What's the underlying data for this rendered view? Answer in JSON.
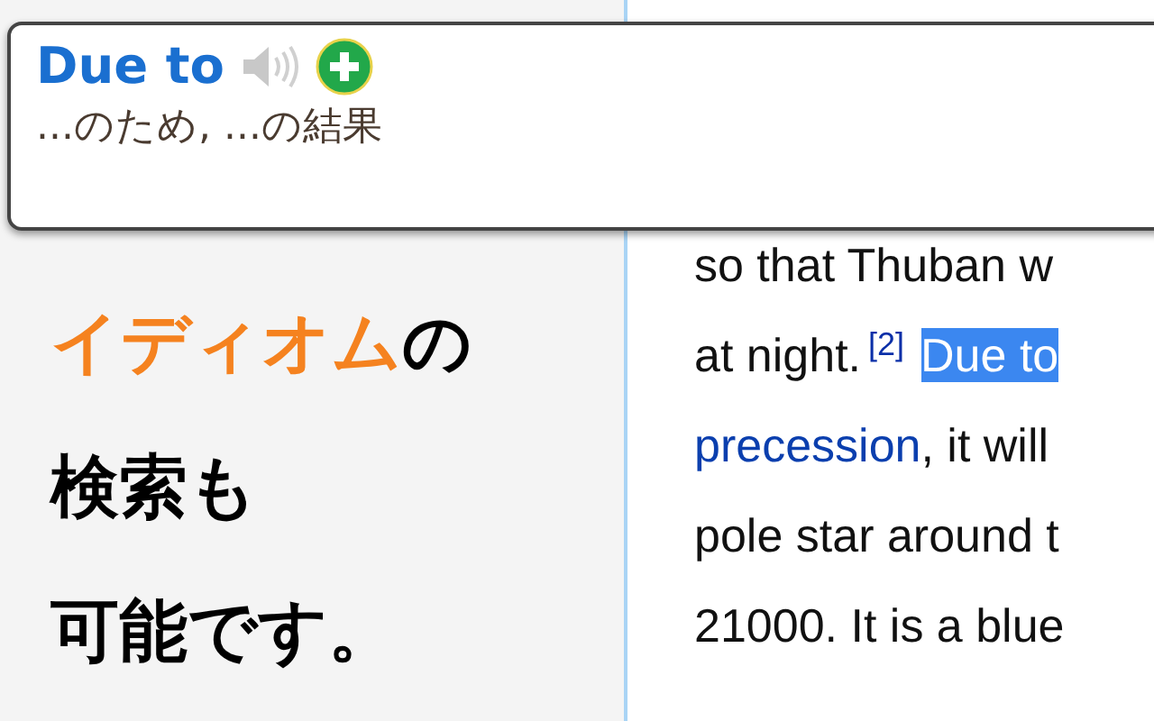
{
  "popup": {
    "term": "Due to",
    "meaning": "...のため, ...の結果",
    "audio_disabled": true
  },
  "tagline": [
    {
      "parts": [
        {
          "text": "イディオム",
          "accent": true
        },
        {
          "text": "の",
          "accent": false
        }
      ]
    },
    {
      "parts": [
        {
          "text": "検索も",
          "accent": false
        }
      ]
    },
    {
      "parts": [
        {
          "text": "可能です。",
          "accent": false
        }
      ]
    }
  ],
  "article": {
    "lines": [
      {
        "segments": [
          {
            "kind": "text",
            "text": "so that Thuban w"
          }
        ]
      },
      {
        "segments": [
          {
            "kind": "text",
            "text": "at night."
          },
          {
            "kind": "ref",
            "text": "[2]"
          },
          {
            "kind": "highlight",
            "text": "Due to"
          }
        ]
      },
      {
        "segments": [
          {
            "kind": "link",
            "text": "precession"
          },
          {
            "kind": "text",
            "text": ", it will"
          }
        ]
      },
      {
        "segments": [
          {
            "kind": "text",
            "text": "pole star around t"
          }
        ]
      },
      {
        "segments": [
          {
            "kind": "text",
            "text": "21000. It is a blue"
          }
        ]
      }
    ]
  }
}
